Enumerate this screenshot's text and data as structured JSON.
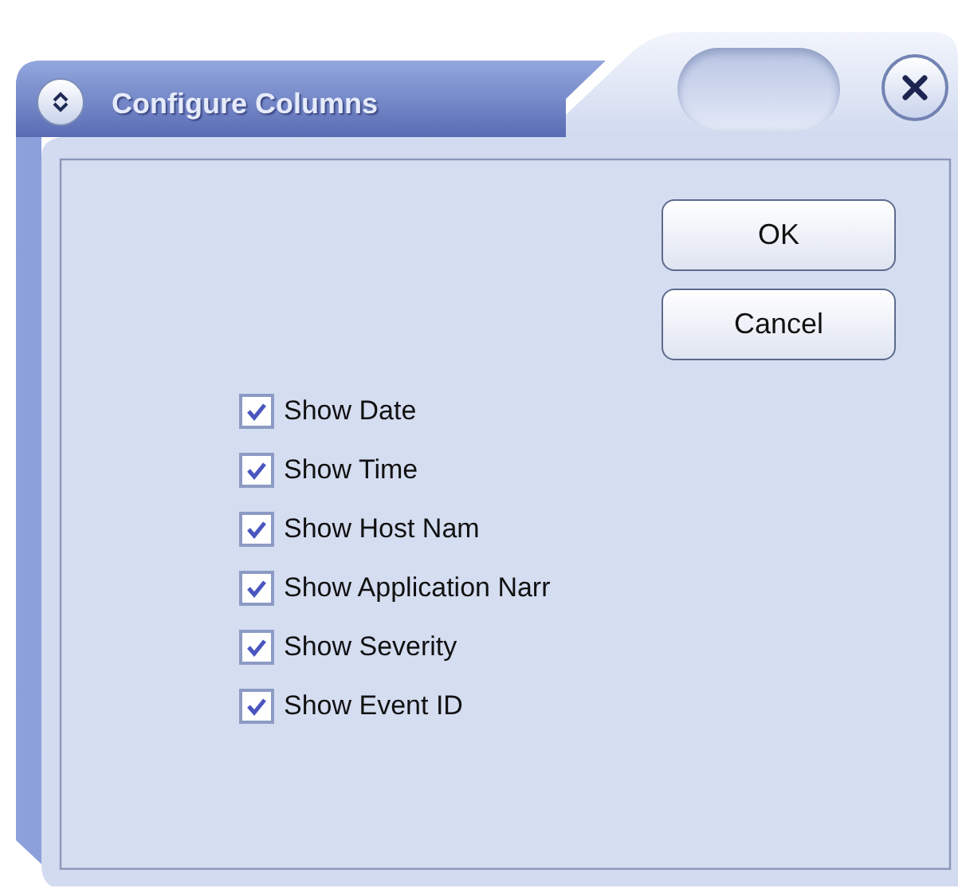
{
  "window": {
    "title": "Configure Columns"
  },
  "buttons": [
    {
      "label": "OK"
    },
    {
      "label": "Cancel"
    }
  ],
  "options": [
    {
      "label": "Show Date",
      "checked": true
    },
    {
      "label": "Show Time",
      "checked": true
    },
    {
      "label": "Show Host Nam",
      "checked": true
    },
    {
      "label": "Show Application Narr",
      "checked": true
    },
    {
      "label": "Show Severity",
      "checked": true
    },
    {
      "label": "Show Event ID",
      "checked": true
    }
  ]
}
